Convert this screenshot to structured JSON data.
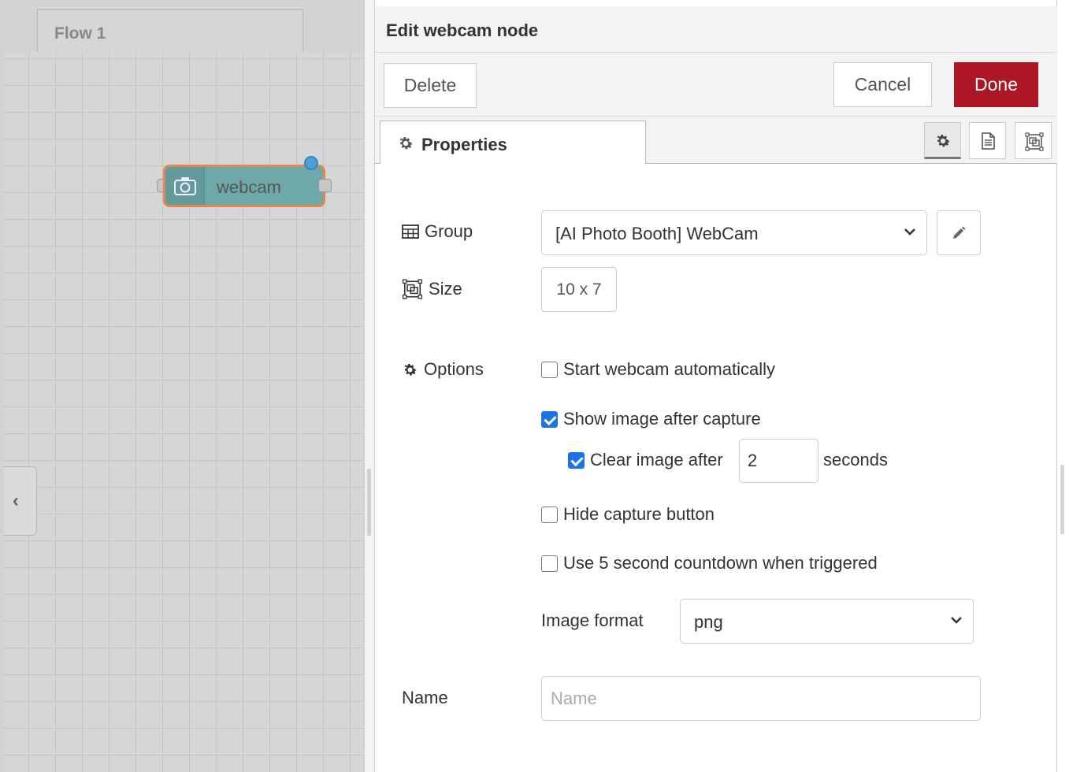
{
  "canvas": {
    "flow_tab_label": "Flow 1",
    "node": {
      "label": "webcam",
      "icon": "camera-icon",
      "color": "#6ea9aa",
      "border_color": "#e0884f"
    },
    "collapse_icon": "chevron-left-icon"
  },
  "editor": {
    "title": "Edit webcam node",
    "buttons": {
      "delete": "Delete",
      "cancel": "Cancel",
      "done": "Done",
      "done_color": "#ad1625"
    },
    "tabs": {
      "properties": "Properties",
      "icons": [
        "gear-icon",
        "description-icon",
        "appearance-icon"
      ]
    },
    "form": {
      "group": {
        "label": "Group",
        "value": "[AI Photo Booth] WebCam"
      },
      "size": {
        "label": "Size",
        "value": "10 x 7"
      },
      "options": {
        "label": "Options",
        "start_auto": {
          "label": "Start webcam automatically",
          "checked": false
        },
        "show_image": {
          "label": "Show image after capture",
          "checked": true
        },
        "clear_image": {
          "label": "Clear image after",
          "checked": true,
          "value": "2",
          "suffix": "seconds"
        },
        "hide_capture": {
          "label": "Hide capture button",
          "checked": false
        },
        "countdown": {
          "label": "Use 5 second countdown when triggered",
          "checked": false
        },
        "image_format": {
          "label": "Image format",
          "value": "png"
        }
      },
      "name": {
        "label": "Name",
        "placeholder": "Name",
        "value": ""
      }
    }
  }
}
